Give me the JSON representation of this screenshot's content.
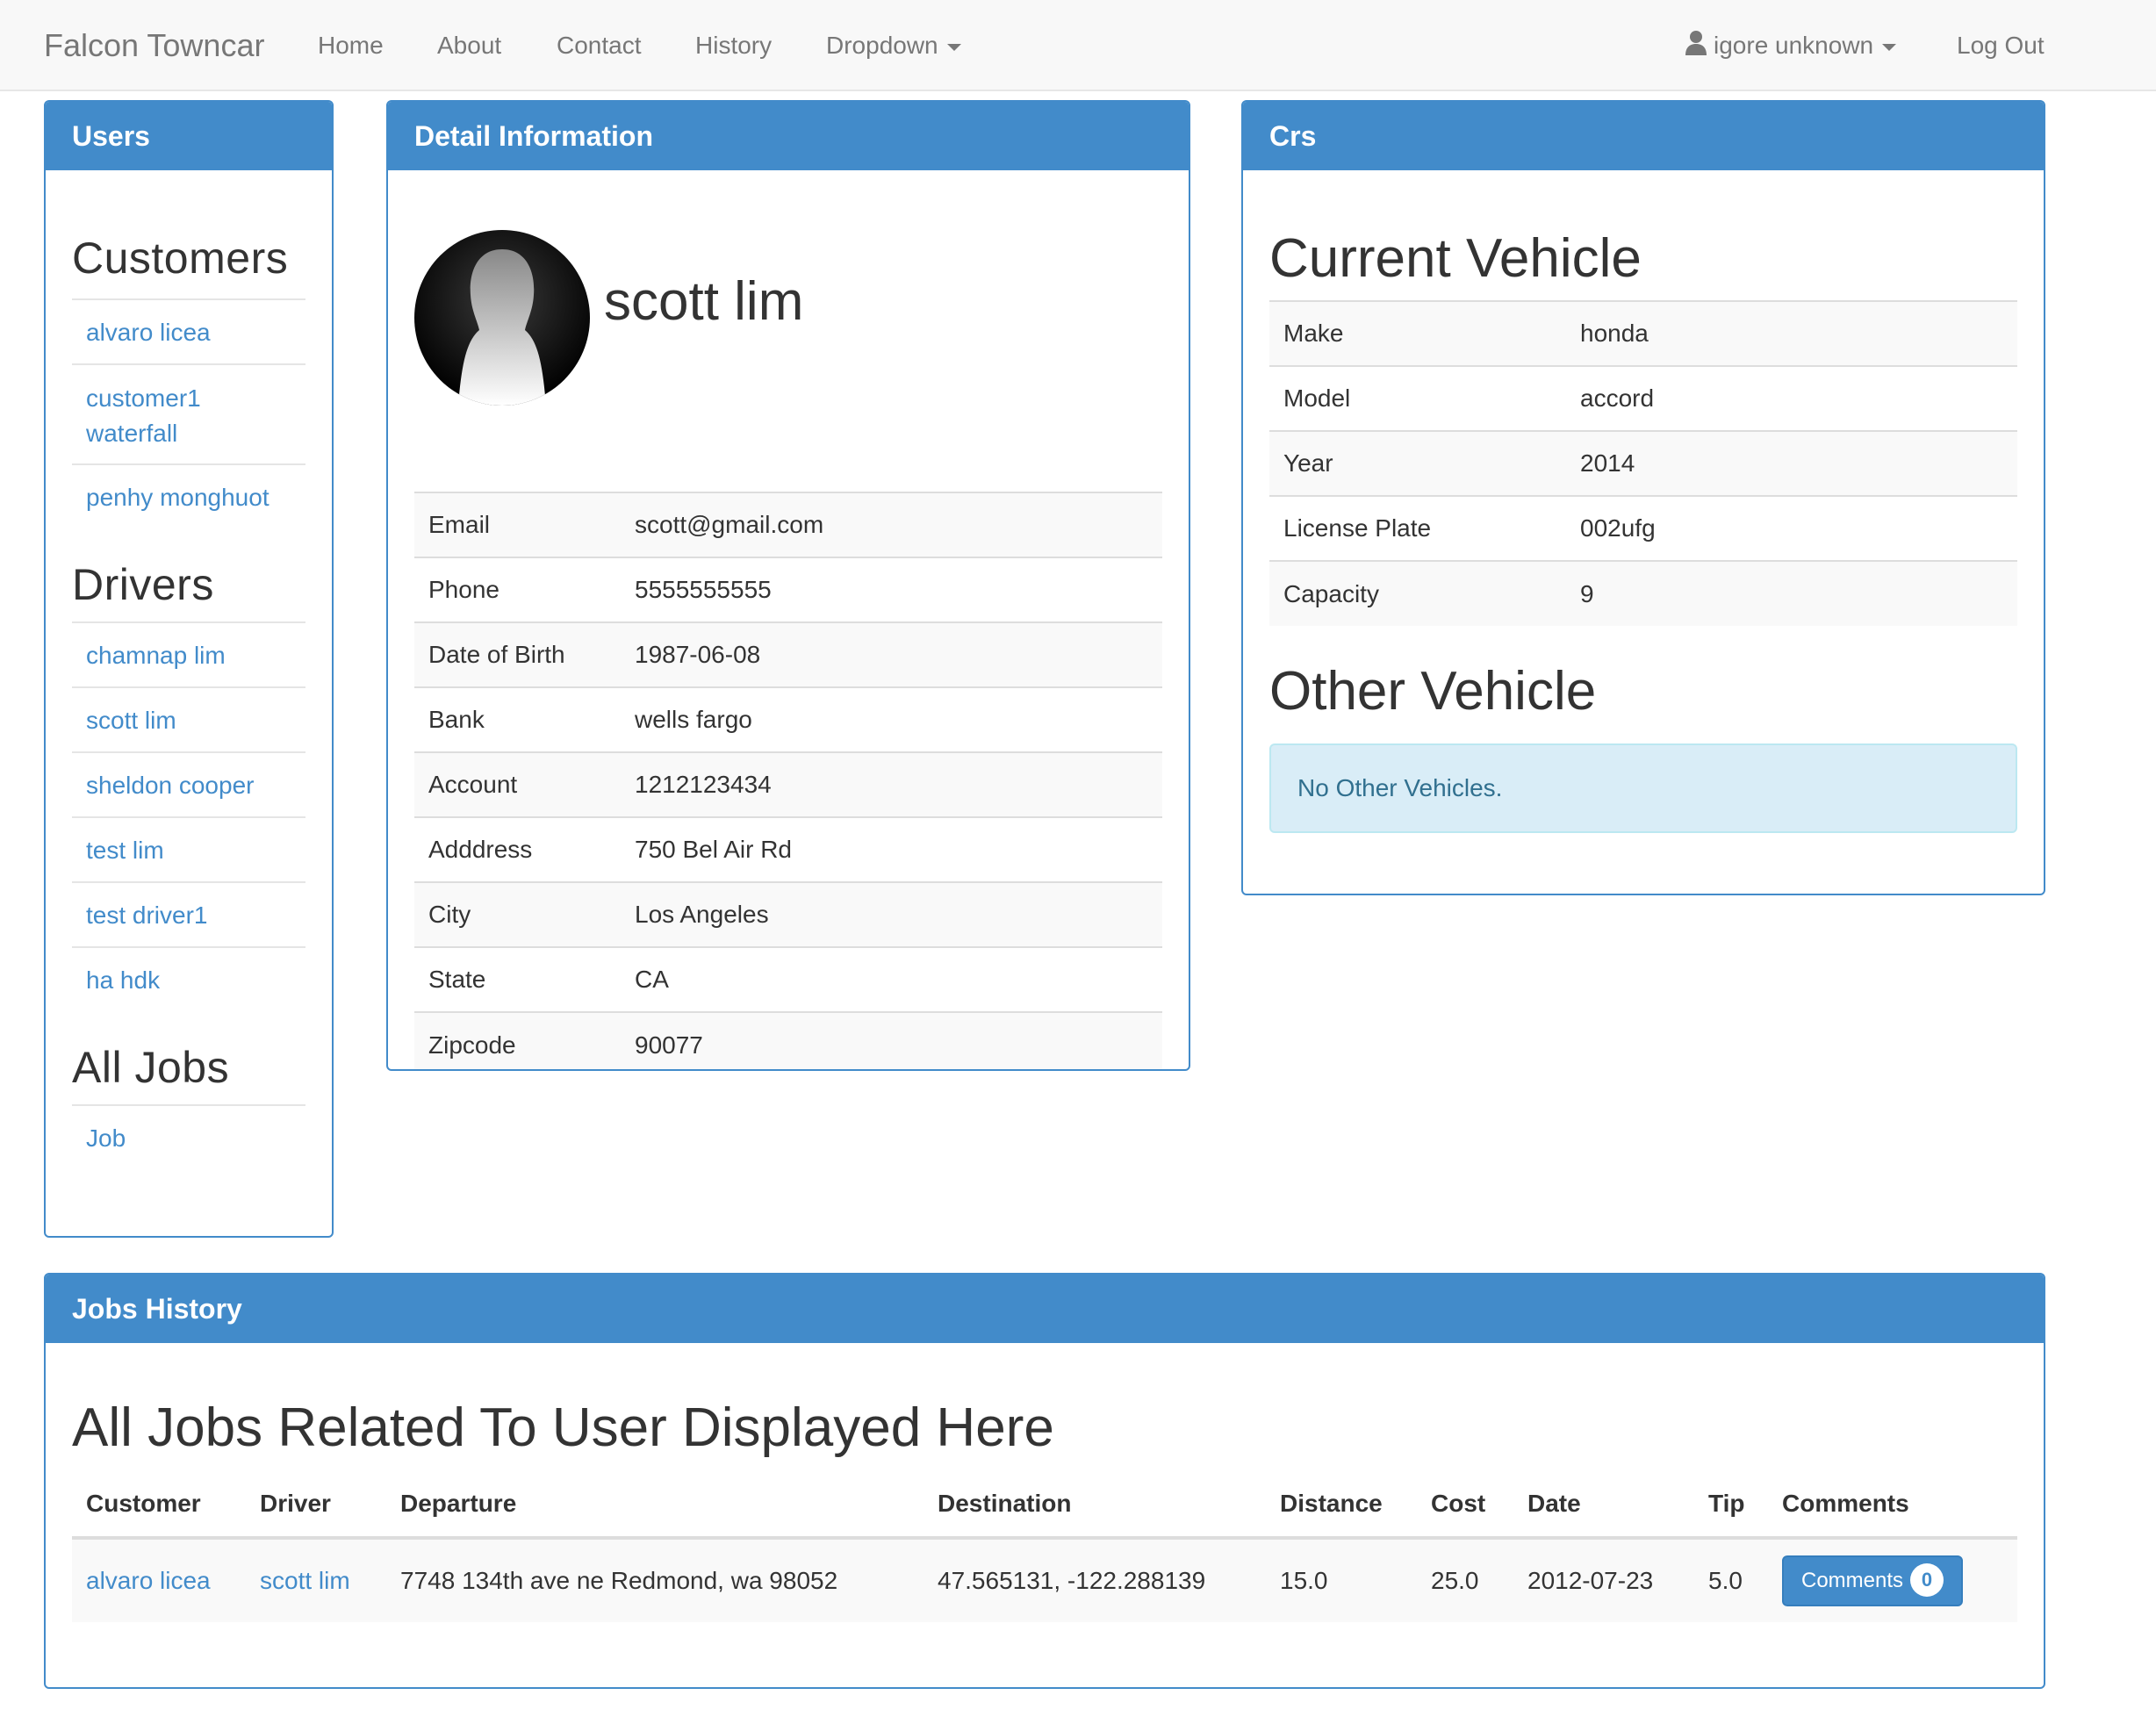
{
  "navbar": {
    "brand": "Falcon Towncar",
    "links": [
      "Home",
      "About",
      "Contact",
      "History"
    ],
    "dropdown": "Dropdown",
    "user": "igore unknown",
    "logout": "Log Out"
  },
  "users_panel": {
    "heading": "Users",
    "customers_title": "Customers",
    "customers": [
      "alvaro licea",
      "customer1 waterfall",
      "penhy monghuot"
    ],
    "drivers_title": "Drivers",
    "drivers": [
      "chamnap lim",
      "scott lim",
      "sheldon cooper",
      "test lim",
      "test driver1",
      "ha hdk"
    ],
    "jobs_title": "All Jobs",
    "jobs": [
      "Job"
    ]
  },
  "detail_panel": {
    "heading": "Detail Information",
    "name": "scott lim",
    "rows": [
      {
        "label": "Email",
        "value": "scott@gmail.com"
      },
      {
        "label": "Phone",
        "value": "5555555555"
      },
      {
        "label": "Date of Birth",
        "value": "1987-06-08"
      },
      {
        "label": "Bank",
        "value": "wells fargo"
      },
      {
        "label": "Account",
        "value": "1212123434"
      },
      {
        "label": "Adddress",
        "value": "750 Bel Air Rd"
      },
      {
        "label": "City",
        "value": "Los Angeles"
      },
      {
        "label": "State",
        "value": "CA"
      },
      {
        "label": "Zipcode",
        "value": "90077"
      }
    ]
  },
  "cars_panel": {
    "heading": "Crs",
    "current_title": "Current Vehicle",
    "rows": [
      {
        "label": "Make",
        "value": "honda"
      },
      {
        "label": "Model",
        "value": "accord"
      },
      {
        "label": "Year",
        "value": "2014"
      },
      {
        "label": "License Plate",
        "value": "002ufg"
      },
      {
        "label": "Capacity",
        "value": "9"
      }
    ],
    "other_title": "Other Vehicle",
    "other_message": "No Other Vehicles."
  },
  "jobs_panel": {
    "heading": "Jobs History",
    "title": "All Jobs Related To User Displayed Here",
    "columns": [
      "Customer",
      "Driver",
      "Departure",
      "Destination",
      "Distance",
      "Cost",
      "Date",
      "Tip",
      "Comments"
    ],
    "rows": [
      {
        "customer": "alvaro licea",
        "driver": "scott lim",
        "departure": "7748 134th ave ne Redmond, wa 98052",
        "destination": "47.565131, -122.288139",
        "distance": "15.0",
        "cost": "25.0",
        "date": "2012-07-23",
        "tip": "5.0",
        "comments_label": "Comments",
        "comments_count": "0"
      }
    ]
  },
  "colors": {
    "primary": "#428bca",
    "info_bg": "#d9edf7",
    "info_text": "#31708f"
  }
}
